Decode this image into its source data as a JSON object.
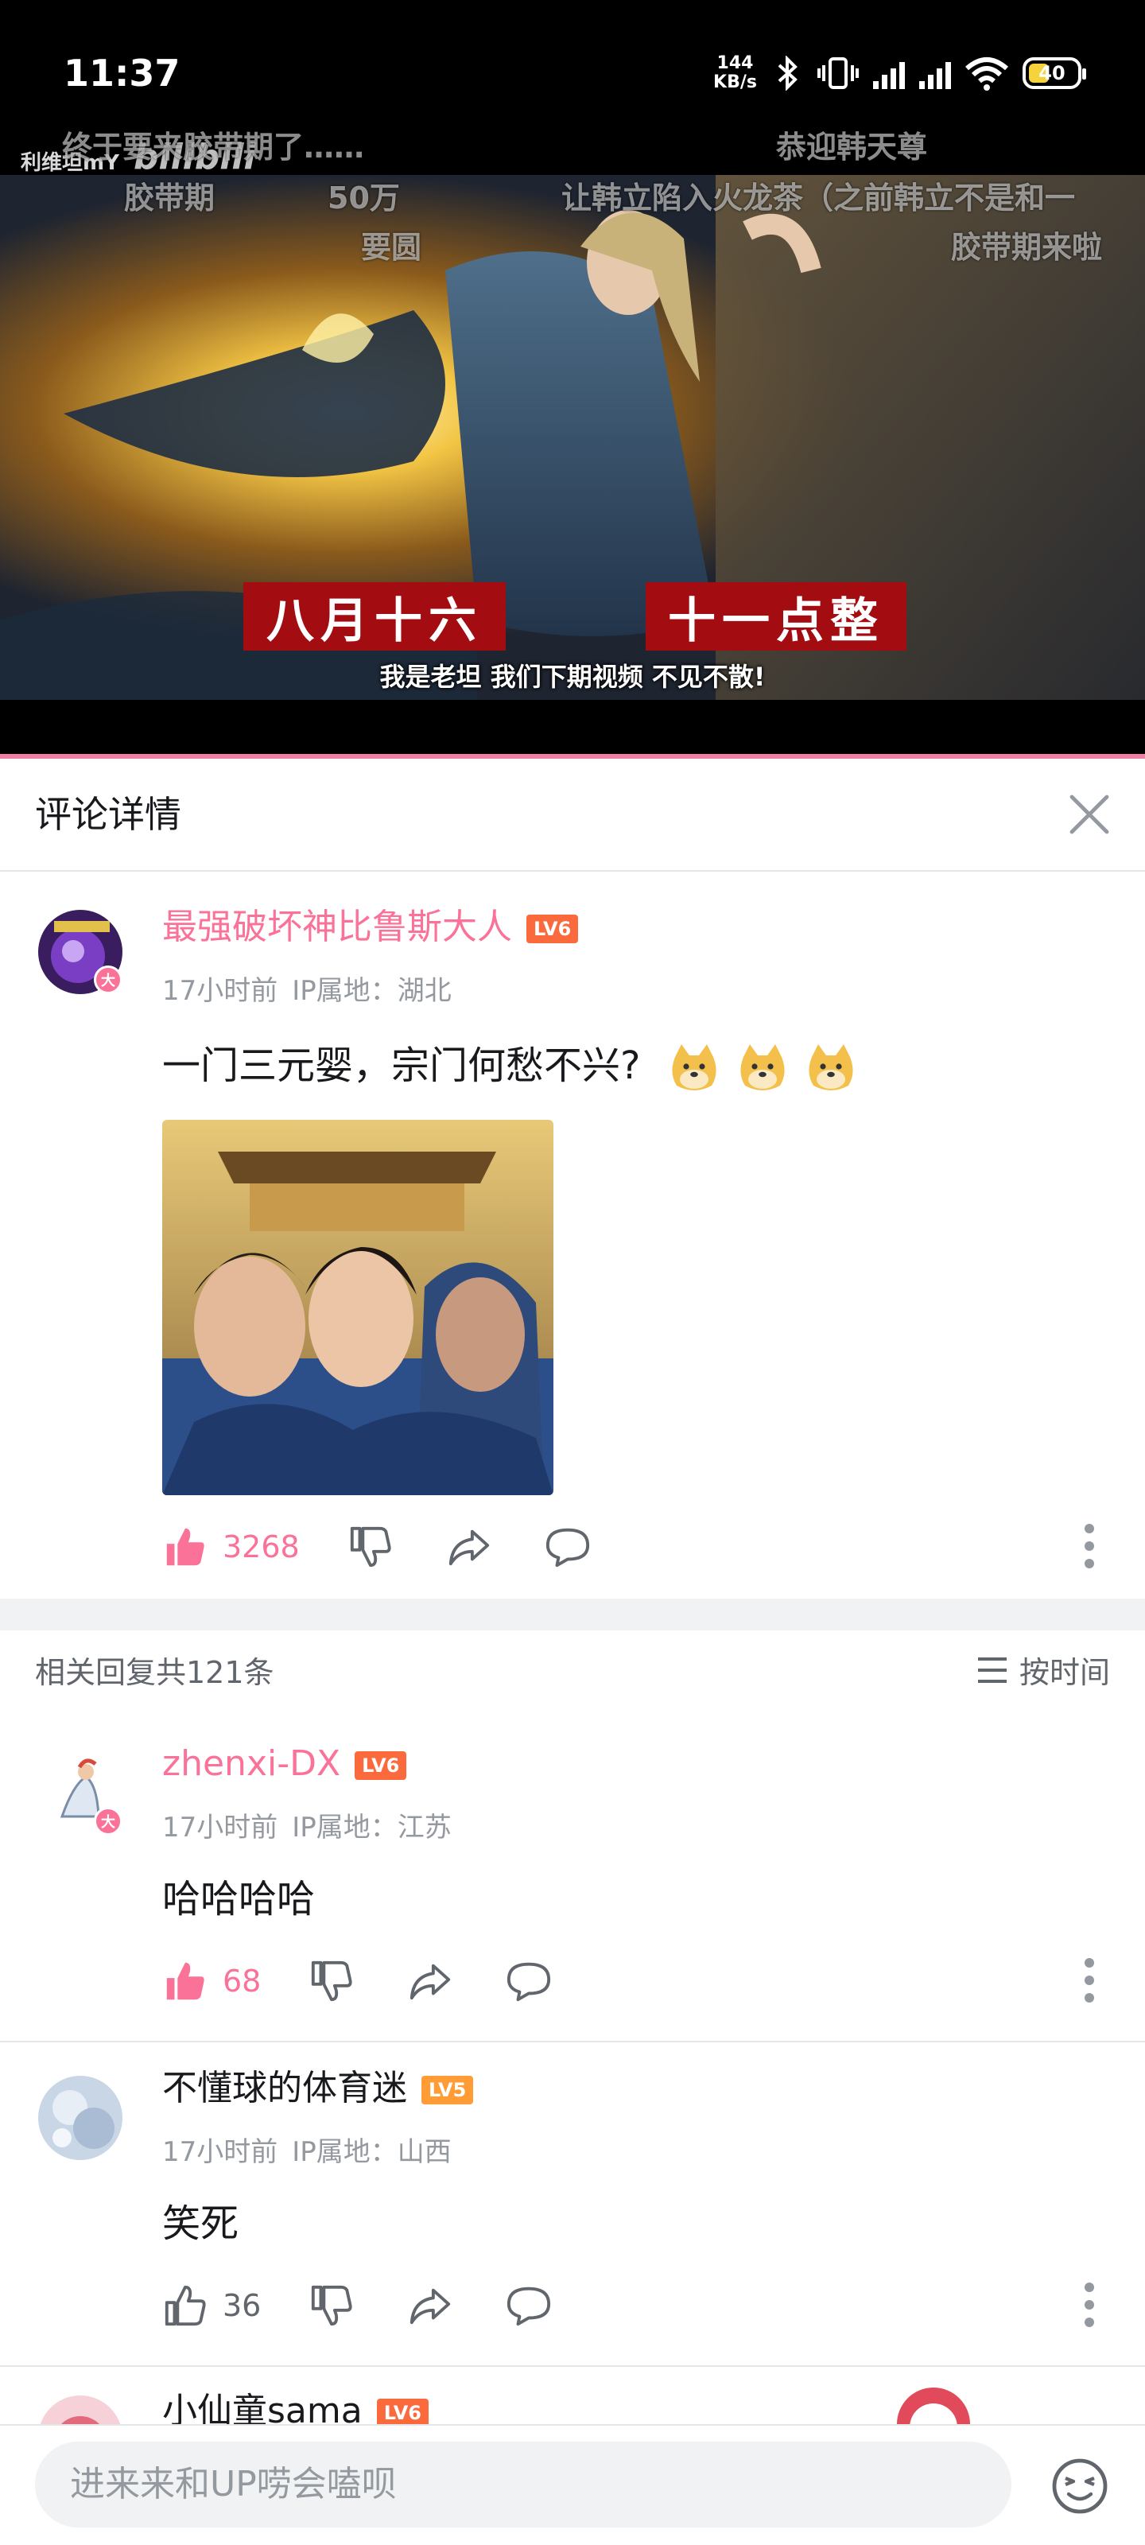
{
  "status_bar": {
    "time": "11:37",
    "net_speed_value": "144",
    "net_speed_unit": "KB/s",
    "battery": "40",
    "icons": [
      "bluetooth-icon",
      "vibrate-icon",
      "signal-hd-icon",
      "signal-hd-icon",
      "wifi-icon",
      "battery-icon"
    ]
  },
  "video": {
    "uploader_watermark": "利维坦mY",
    "platform_watermark": "bilibili",
    "danmaku": [
      "终于要来胶带期了……",
      "恭迎韩天尊",
      "胶带期",
      "50万",
      "要圆",
      "让韩立陷入火龙茶（之前韩立不是和一",
      "胶带期来啦"
    ],
    "banner_left": "八月十六",
    "banner_right": "十一点整",
    "subtitle": "我是老坦 我们下期视频 不见不散!"
  },
  "panel": {
    "title": "评论详情",
    "close_icon": "close-icon"
  },
  "main_comment": {
    "username": "最强破坏神比鲁斯大人",
    "level": "LV6",
    "avatar_badge": "大",
    "time": "17小时前",
    "ip": "IP属地：湖北",
    "text": "一门三元婴，宗门何愁不兴?",
    "emotes": [
      "doge-emote",
      "doge-emote",
      "doge-emote"
    ],
    "likes": "3268"
  },
  "replies_header": {
    "count_text": "相关回复共121条",
    "sort_label": "按时间"
  },
  "replies": [
    {
      "username": "zhenxi-DX",
      "level": "LV6",
      "avatar_badge": "大",
      "time": "17小时前",
      "ip": "IP属地：江苏",
      "text": "哈哈哈哈",
      "likes": "68"
    },
    {
      "username": "不懂球的体育迷",
      "level": "LV5",
      "time": "17小时前",
      "ip": "IP属地：山西",
      "text": "笑死",
      "likes": "36"
    },
    {
      "username": "小仙童sama",
      "level": "LV6"
    }
  ],
  "input_bar": {
    "placeholder": "进来来和UP唠会嗑呗",
    "emoji_icon": "emoji-face-icon"
  },
  "colors": {
    "accent_pink": "#fb7299",
    "level_orange": "#fb6a3c",
    "muted_text": "#9499a0"
  }
}
